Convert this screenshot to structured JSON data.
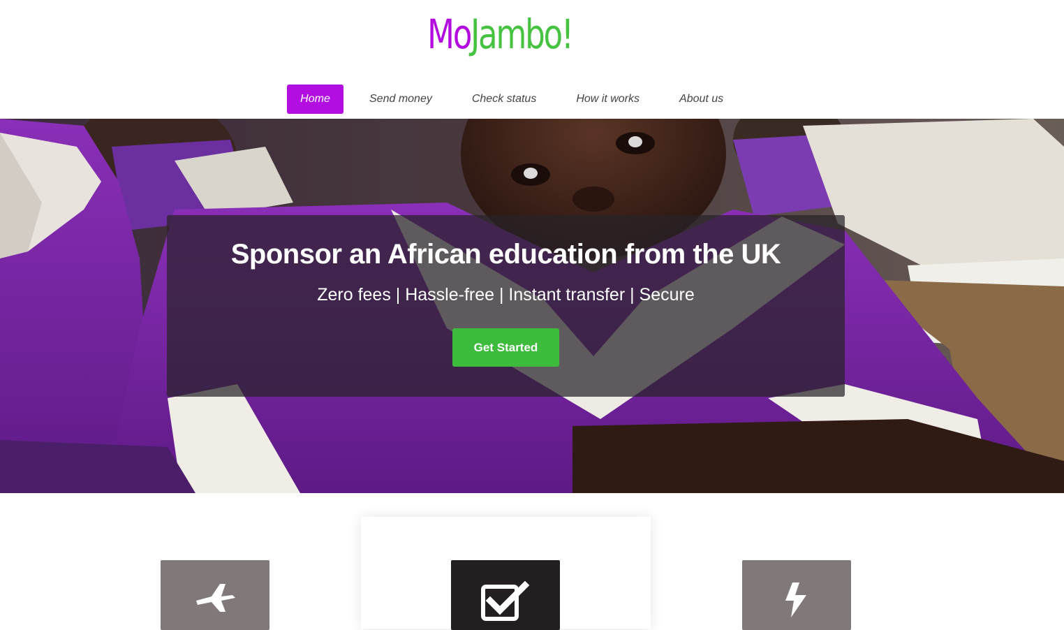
{
  "header": {
    "logo_part_a": "Mo",
    "logo_part_b": "Jambo!",
    "nav": [
      {
        "label": "Home",
        "active": true
      },
      {
        "label": "Send money",
        "active": false
      },
      {
        "label": "Check status",
        "active": false
      },
      {
        "label": "How it works",
        "active": false
      },
      {
        "label": "About us",
        "active": false
      }
    ]
  },
  "hero": {
    "title": "Sponsor an African education from the UK",
    "subtitle": "Zero fees | Hassle-free | Instant transfer | Secure",
    "cta_label": "Get Started",
    "image": "schoolchild-photo"
  },
  "features": {
    "icons": [
      "airplane-icon",
      "checkbox-icon",
      "lightning-icon"
    ]
  },
  "colors": {
    "brand_purple": "#b20ee2",
    "brand_green": "#3dbb3d",
    "icon_box_grey": "#807879",
    "icon_box_dark": "#231f20"
  }
}
